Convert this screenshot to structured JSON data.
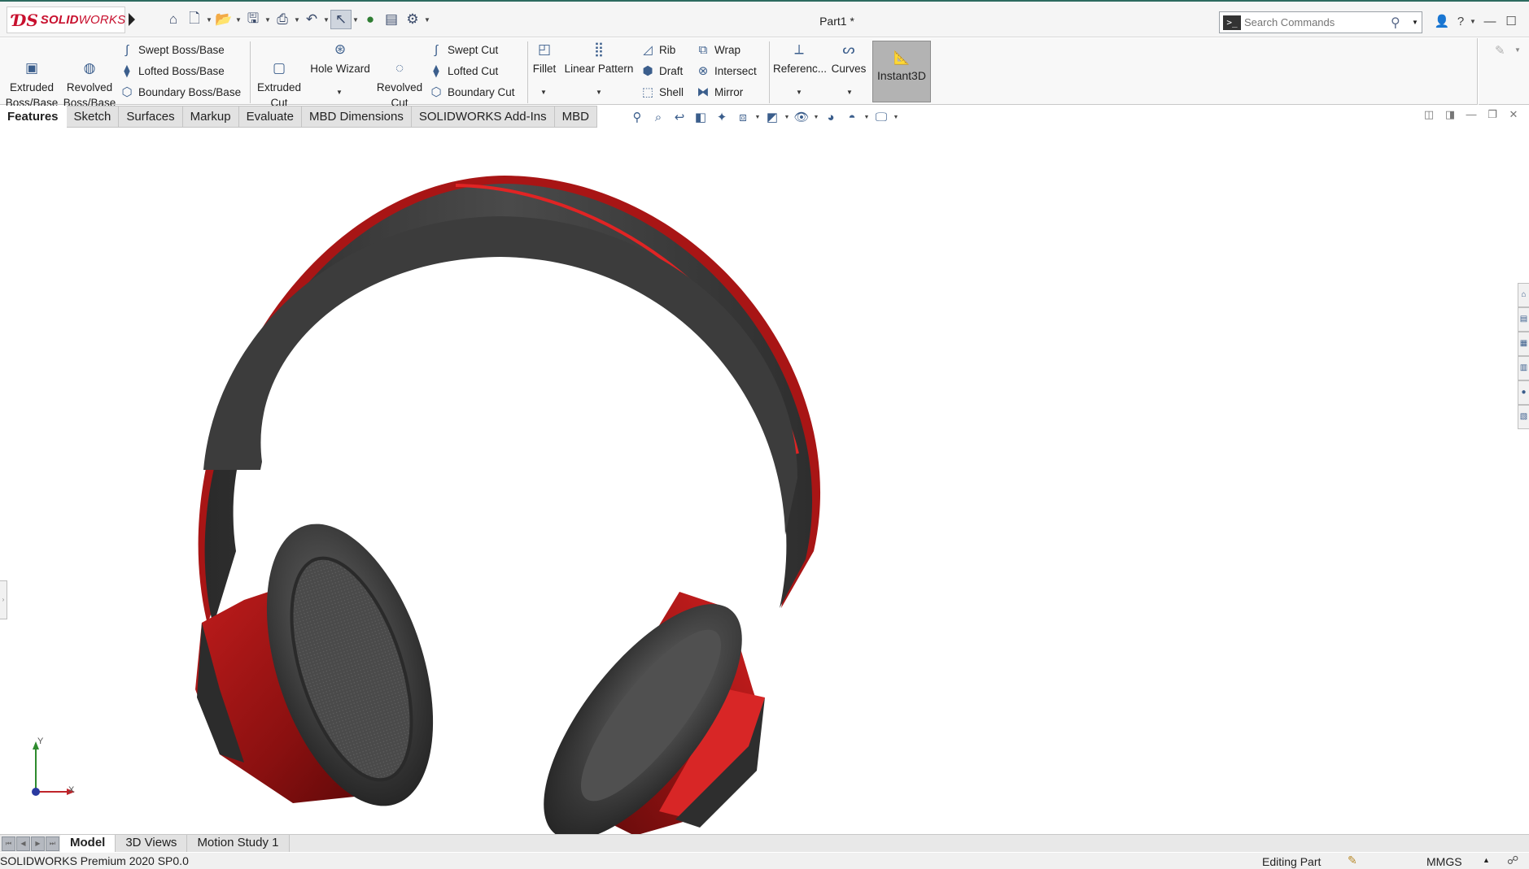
{
  "brand": {
    "ds": "ƊS",
    "solid": "SOLID",
    "works": "WORKS"
  },
  "document": {
    "title": "Part1 *"
  },
  "quick_access": [
    "home-icon",
    "new-document-icon",
    "open-icon",
    "save-icon",
    "print-icon",
    "undo-icon",
    "select-cursor-icon",
    "rebuild-icon",
    "file-properties-icon",
    "options-gear-icon"
  ],
  "search": {
    "placeholder": "Search Commands"
  },
  "ribbon": {
    "extruded_boss": "Extruded\nBoss/Base",
    "revolved_boss": "Revolved\nBoss/Base",
    "swept_boss": "Swept Boss/Base",
    "lofted_boss": "Lofted Boss/Base",
    "boundary_boss": "Boundary Boss/Base",
    "extruded_cut": "Extruded\nCut",
    "hole_wizard": "Hole Wizard",
    "revolved_cut": "Revolved\nCut",
    "swept_cut": "Swept Cut",
    "lofted_cut": "Lofted Cut",
    "boundary_cut": "Boundary Cut",
    "fillet": "Fillet",
    "linear_pattern": "Linear Pattern",
    "rib": "Rib",
    "draft": "Draft",
    "shell": "Shell",
    "wrap": "Wrap",
    "intersect": "Intersect",
    "mirror": "Mirror",
    "reference": "Referenc...",
    "curves": "Curves",
    "instant3d": "Instant3D"
  },
  "tabs": [
    "Features",
    "Sketch",
    "Surfaces",
    "Markup",
    "Evaluate",
    "MBD Dimensions",
    "SOLIDWORKS Add-Ins",
    "MBD"
  ],
  "active_tab": "Features",
  "bottom_tabs": [
    "Model",
    "3D Views",
    "Motion Study 1"
  ],
  "active_bottom_tab": "Model",
  "axes": {
    "x": "X",
    "y": "Y"
  },
  "status": {
    "product": "SOLIDWORKS Premium 2020 SP0.0",
    "mode": "Editing Part",
    "units": "MMGS"
  },
  "colors": {
    "accent_red": "#c8102e",
    "model_red": "#b01818",
    "model_dark": "#3a3a3a"
  }
}
